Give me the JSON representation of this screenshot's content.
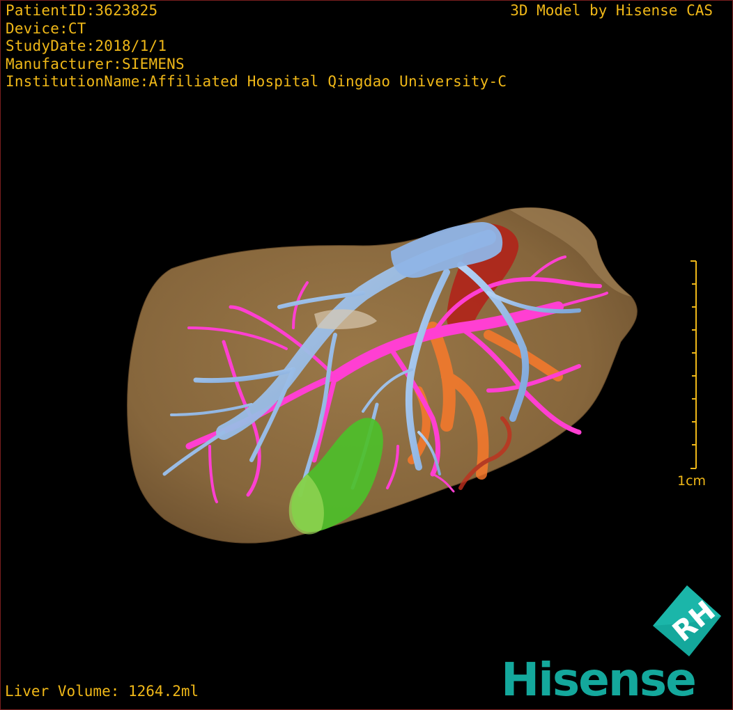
{
  "viewer": {
    "patient_id": "PatientID:3623825",
    "device": "Device:CT",
    "study_date": "StudyDate:2018/1/1",
    "manufacturer": "Manufacturer:SIEMENS",
    "institution": "InstitutionName:Affiliated Hospital Qingdao University-C",
    "credit": "3D Model by Hisense CAS",
    "liver_volume": "Liver Volume: 1264.2ml",
    "scale_label": "1cm"
  },
  "logo": {
    "wordmark": "Hisense",
    "cube_letters": "RH"
  },
  "colors": {
    "text": "#f0b818",
    "liver": "#8a6a3e",
    "hepatic_vein": "#9cc0ea",
    "portal_vein": "#ff3fd2",
    "artery": "#ff7a2a",
    "ivc": "#b0241a",
    "tumor": "#4dbf2a",
    "brand": "#14a89c"
  }
}
